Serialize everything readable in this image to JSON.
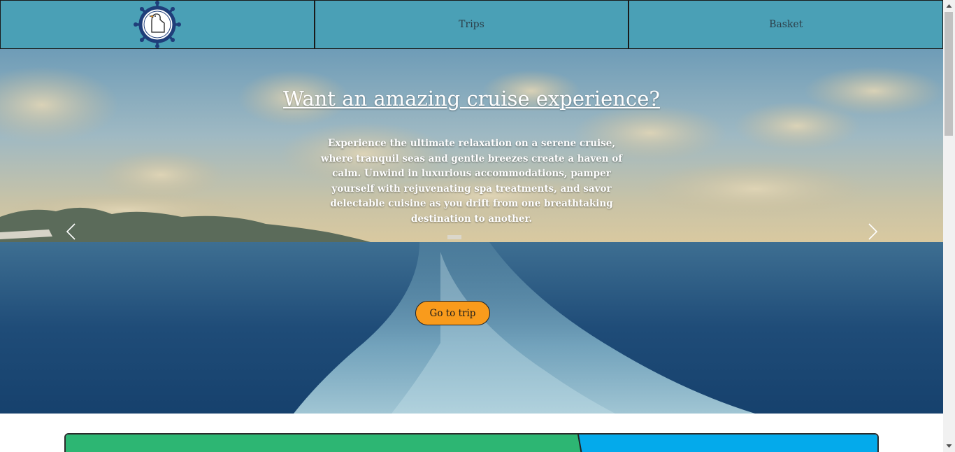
{
  "nav": {
    "logo_name": "ship-wheel-duck-logo",
    "items": [
      {
        "label": "Trips"
      },
      {
        "label": "Basket"
      }
    ]
  },
  "hero": {
    "title": "Want an amazing cruise experience?",
    "description": "Experience the ultimate relaxation on a serene cruise, where tranquil seas and gentle breezes create a haven of calm. Unwind in luxurious accommodations, pamper yourself with rejuvenating spa treatments, and savor delectable cuisine as you drift from one breathtaking destination to another.",
    "cta_label": "Go to trip",
    "prev_icon": "chevron-left-icon",
    "next_icon": "chevron-right-icon"
  },
  "colors": {
    "nav_bg": "#4aa0b6",
    "cta_bg": "#f99b1c",
    "panel_green": "#2db673",
    "panel_blue": "#04aaeb"
  }
}
